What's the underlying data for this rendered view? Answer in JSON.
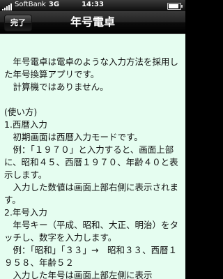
{
  "status": {
    "carrier": "SoftBank",
    "network": "3G",
    "time": "14:33"
  },
  "nav": {
    "done": "完了",
    "title": "年号電卓"
  },
  "body": {
    "intro": "　年号電卓は電卓のような入力方法を採用した年号換算アプリです。",
    "note": "　計算機ではありません。",
    "usage_heading": "(使い方)",
    "s1_title": "1.西暦入力",
    "s1_p1": "　初期画面は西暦入力モードです。",
    "s1_p2": "　例：「１９７０」と入力すると、画面上部に、昭和４５、西暦１９７０、年齢４０と表示します。",
    "s1_p3": "　入力した数値は画面上部右側に表示されます。",
    "s2_title": "2.年号入力",
    "s2_p1": "　年号キー（平成、昭和、大正、明治）をタッチし、数字を入力します。",
    "s2_p2": "　例：「昭和」「３３」→　昭和３３、西暦１９５８、年齢５２",
    "s2_p3": "　入力した年号は画面上部左側に表示"
  }
}
